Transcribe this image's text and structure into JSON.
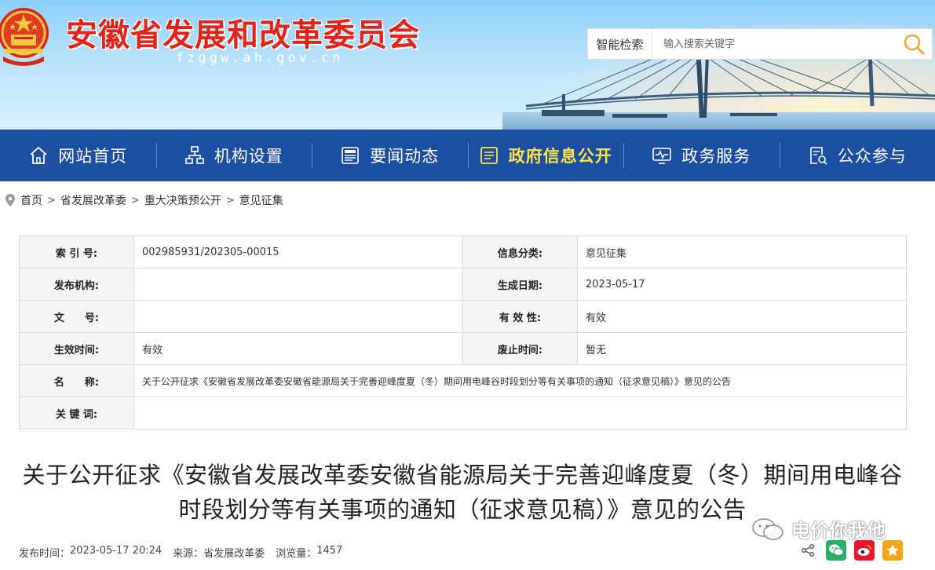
{
  "header": {
    "site_title": "安徽省发展和改革委员会",
    "site_domain": "fzggw.ah.gov.cn",
    "emblem_icon": "national-emblem-icon",
    "search": {
      "label": "智能检索",
      "placeholder": "输入搜索关键字"
    }
  },
  "nav": {
    "items": [
      {
        "label": "网站首页",
        "icon": "home-icon"
      },
      {
        "label": "机构设置",
        "icon": "org-chart-icon"
      },
      {
        "label": "要闻动态",
        "icon": "news-icon"
      },
      {
        "label": "政府信息公开",
        "icon": "document-list-icon",
        "active": true
      },
      {
        "label": "政务服务",
        "icon": "monitor-icon"
      },
      {
        "label": "公众参与",
        "icon": "form-search-icon"
      }
    ],
    "active_color": "#ffe34d",
    "bg_color": "#1c4fa0"
  },
  "breadcrumb": {
    "items": [
      "首页",
      "省发展改革委",
      "重大决策预公开",
      "意见征集"
    ]
  },
  "info": {
    "index_no_label": "索 引 号:",
    "index_no": "002985931/202305-00015",
    "category_label": "信息分类:",
    "category": "意见征集",
    "publisher_label": "发布机构:",
    "publisher": "",
    "created_label": "生成日期:",
    "created": "2023-05-17",
    "doc_no_label": "文　　号:",
    "doc_no": "",
    "validity_label": "有 效 性:",
    "validity": "有效",
    "effective_label": "生效时间:",
    "effective": "有效",
    "repeal_label": "废止时间:",
    "repeal": "暂无",
    "name_label": "名　　称:",
    "name": "关于公开征求《安徽省发展改革委安徽省能源局关于完善迎峰度夏（冬）期间用电峰谷时段划分等有关事项的通知（征求意见稿）》意见的公告",
    "keywords_label": "关 键 词:",
    "keywords": ""
  },
  "article": {
    "title": "关于公开征求《安徽省发展改革委安徽省能源局关于完善迎峰度夏（冬）期间用电峰谷时段划分等有关事项的通知（征求意见稿）》意见的公告",
    "publish_label": "发布时间：",
    "publish_time": "2023-05-17 20:24",
    "source_label": "来源：",
    "source": "省发展改革委",
    "views_label": "浏览量：",
    "views": "1457"
  },
  "watermark": {
    "text": "电价你我他",
    "icon": "wechat-official-account-icon"
  },
  "share": {
    "items": [
      "share-icon",
      "wechat-icon",
      "weibo-icon",
      "favorite-icon"
    ],
    "colors": {
      "wechat": "#2aae67",
      "weibo": "#e6162d",
      "favorite": "#f2a51a"
    }
  }
}
